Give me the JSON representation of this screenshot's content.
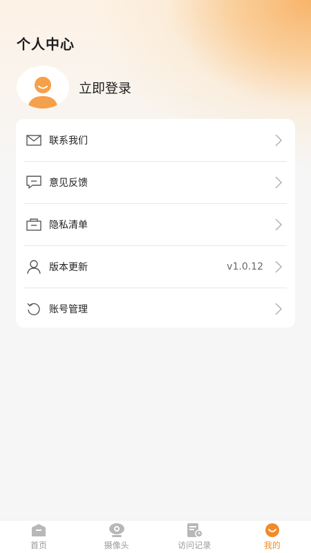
{
  "header": {
    "title": "个人中心"
  },
  "profile": {
    "login_label": "立即登录"
  },
  "menu": [
    {
      "label": "联系我们",
      "icon": "mail-icon",
      "value": ""
    },
    {
      "label": "意见反馈",
      "icon": "chat-icon",
      "value": ""
    },
    {
      "label": "隐私清单",
      "icon": "inbox-icon",
      "value": ""
    },
    {
      "label": "版本更新",
      "icon": "person-icon",
      "value": "v1.0.12"
    },
    {
      "label": "账号管理",
      "icon": "refresh-icon",
      "value": ""
    }
  ],
  "tabs": [
    {
      "label": "首页",
      "icon": "home-icon",
      "active": false
    },
    {
      "label": "摄像头",
      "icon": "camera-icon",
      "active": false
    },
    {
      "label": "访问记录",
      "icon": "record-icon",
      "active": false
    },
    {
      "label": "我的",
      "icon": "smile-icon",
      "active": true
    }
  ],
  "colors": {
    "accent": "#f28a2a",
    "avatar": "#f5a04a",
    "background": "#f6f6f6"
  }
}
